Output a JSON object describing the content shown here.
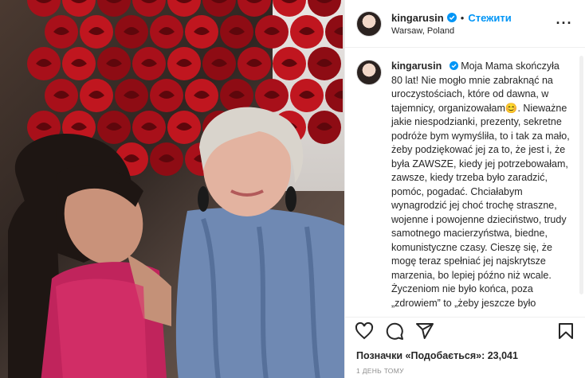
{
  "header": {
    "username": "kingarusin",
    "separator": "•",
    "follow_label": "Стежити",
    "location": "Warsaw, Poland",
    "more_label": "···"
  },
  "caption": {
    "username": "kingarusin",
    "text": "Moja Mama skończyła 80 lat! Nie mogło mnie zabraknąć na uroczystościach, które od dawna, w tajemnicy, organizowałam😊. Nieważne jakie niespodzianki, prezenty, sekretne podróże bym wymyśliła, to i tak za mało, żeby podziękować jej za to, że jest i, że była ZAWSZE, kiedy jej potrzebowałam, zawsze, kiedy trzeba było zaradzić, pomóc, pogadać. Chciałabym wynagrodzić jej choć trochę straszne, wojenne i powojenne dzieciństwo, trudy samotnego macierzyństwa, biedne, komunistyczne czasy. Cieszę się, że mogę teraz spełniać jej najskrytsze marzenia, bo lepiej późno niż wcale. Życzeniom nie było końca, poza „zdrowiem” to „żeby jeszcze było"
  },
  "actions": {
    "like_icon": "heart-icon",
    "comment_icon": "comment-icon",
    "share_icon": "share-icon",
    "save_icon": "bookmark-icon"
  },
  "likes": "Позначки «Подобається»: 23,041",
  "timestamp": "1 день тому",
  "colors": {
    "accent": "#0095f6",
    "text": "#262626",
    "muted": "#8e8e8e",
    "verified": "#0095f6"
  }
}
